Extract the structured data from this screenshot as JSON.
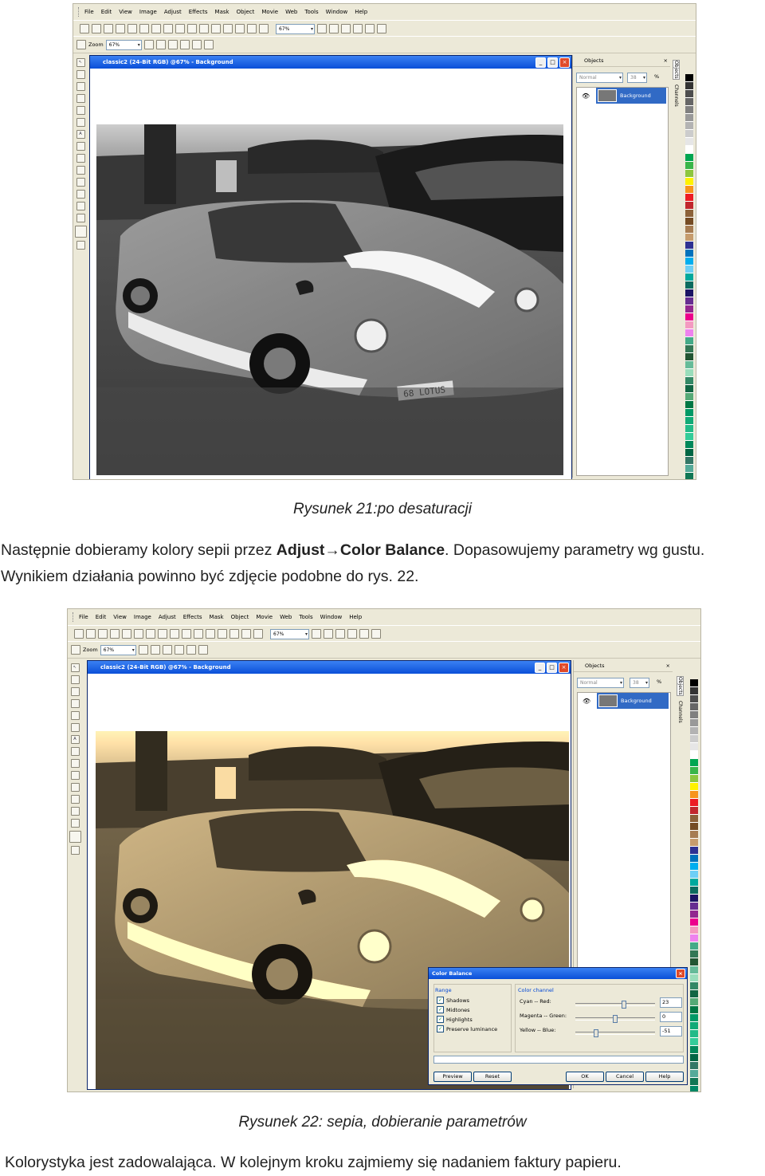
{
  "app": {
    "menu": [
      "File",
      "Edit",
      "View",
      "Image",
      "Adjust",
      "Effects",
      "Mask",
      "Object",
      "Movie",
      "Web",
      "Tools",
      "Window",
      "Help"
    ],
    "zoom_label": "Zoom",
    "zoom_value": "67%",
    "zoom_value_2": "67%",
    "doc_title": "classic2 (24-Bit RGB) @67% - Background",
    "objects_title": "Objects",
    "blend_mode": "Normal",
    "opacity": "38",
    "opacity_unit": "%",
    "layer_name": "Background",
    "tab_objects": "Objects",
    "tab_channels": "Channels",
    "window_close": "×",
    "window_min": "_",
    "window_max": "□"
  },
  "photo": {
    "plate": "68 LOTUS"
  },
  "color_balance": {
    "title": "Color Balance",
    "range_label": "Range",
    "checks": [
      "Shadows",
      "Midtones",
      "Highlights",
      "Preserve luminance"
    ],
    "channel_label": "Color channel",
    "sliders": [
      {
        "label": "Cyan -- Red:",
        "value": "23",
        "pos": 0.62
      },
      {
        "label": "Magenta -- Green:",
        "value": "0",
        "pos": 0.5
      },
      {
        "label": "Yellow -- Blue:",
        "value": "-51",
        "pos": 0.24
      }
    ],
    "buttons": {
      "preview": "Preview",
      "reset": "Reset",
      "ok": "OK",
      "cancel": "Cancel",
      "help": "Help"
    }
  },
  "caption1": "Rysunek 21:po desaturacji",
  "para1": {
    "line1_a": "Następnie dobieramy kolory sepii przez ",
    "line1_b": "Adjust",
    "line1_arrow": "→",
    "line1_c": "Color Balance",
    "line1_d": ". Dopasowujemy parametry wg gustu.",
    "line2": "Wynikiem działania powinno być zdjęcie podobne do rys. 22."
  },
  "caption2": "Rysunek 22: sepia, dobieranie parametrów",
  "para2": "Kolorystyka jest zadowalająca. W kolejnym kroku zajmiemy się nadaniem faktury papieru.",
  "palette_colors": [
    "#000000",
    "#333333",
    "#4d4d4d",
    "#666666",
    "#808080",
    "#999999",
    "#b3b3b3",
    "#cccccc",
    "#e6e6e6",
    "#ffffff",
    "#00a651",
    "#39b54a",
    "#8dc63f",
    "#fff200",
    "#f7941d",
    "#ed1c24",
    "#c1272d",
    "#8c6239",
    "#754c24",
    "#a67c52",
    "#c69c6d",
    "#2e3192",
    "#0072bc",
    "#00aeef",
    "#6dcff6",
    "#00a99d",
    "#0c6b5f",
    "#1b1464",
    "#662d91",
    "#92278f",
    "#ec008c",
    "#f49ac1",
    "#ee82ee",
    "#44aa88",
    "#337755",
    "#225533",
    "#66bb99",
    "#99ddbb",
    "#338866",
    "#116644",
    "#55aa77",
    "#007744",
    "#009966",
    "#11aa77",
    "#22bb88",
    "#33cc99",
    "#00885a",
    "#006644",
    "#337766",
    "#55aa99",
    "#117755",
    "#008866",
    "#226655"
  ]
}
